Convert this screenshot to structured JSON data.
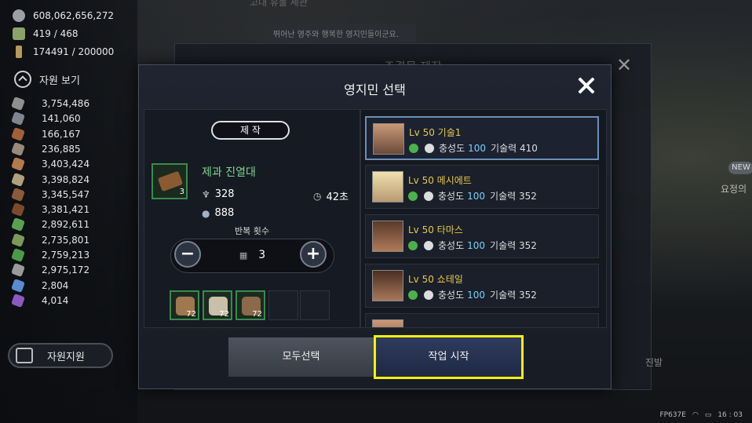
{
  "background": {
    "top_text": "고대 유물 세관",
    "top_box_text": "뛰어난 영주와 행복한 영지민들이군요.",
    "window_title": "주결물 제작",
    "side_badge": "NEW",
    "side_text": "요정의",
    "side_text2": "진발"
  },
  "top_stats": [
    {
      "icon": "silver-coin-icon",
      "color": "#9aa0a6",
      "value": "608,062,656,272"
    },
    {
      "icon": "lordship-icon",
      "color": "#8aa36a",
      "value": "419 / 468"
    },
    {
      "icon": "wheat-icon",
      "color": "#b59a5a",
      "value": "174491 / 200000"
    }
  ],
  "resource_toggle": "자원 보기",
  "resources": [
    {
      "icon": "ore-icon",
      "color": "#8f8f8f",
      "value": "3,754,486"
    },
    {
      "icon": "stone-icon",
      "color": "#7f8590",
      "value": "141,060"
    },
    {
      "icon": "wood-log-icon",
      "color": "#a0603a",
      "value": "166,167"
    },
    {
      "icon": "feather-icon",
      "color": "#9a8a7a",
      "value": "236,885"
    },
    {
      "icon": "hide-icon",
      "color": "#b37a50",
      "value": "3,403,424"
    },
    {
      "icon": "plank-icon",
      "color": "#b0a080",
      "value": "3,398,824"
    },
    {
      "icon": "timber-icon",
      "color": "#8a5a3a",
      "value": "3,345,547"
    },
    {
      "icon": "branch-icon",
      "color": "#7a4a2a",
      "value": "3,381,421"
    },
    {
      "icon": "leaf-icon",
      "color": "#5aa050",
      "value": "2,892,611"
    },
    {
      "icon": "herb-icon",
      "color": "#7a9a5a",
      "value": "2,735,801"
    },
    {
      "icon": "plant-icon",
      "color": "#4a9a4a",
      "value": "2,759,213"
    },
    {
      "icon": "rock-icon",
      "color": "#9a9a9a",
      "value": "2,975,172"
    },
    {
      "icon": "crystal-icon",
      "color": "#5a8ad0",
      "value": "2,804"
    },
    {
      "icon": "gem-icon",
      "color": "#8a5ac0",
      "value": "4,014"
    }
  ],
  "support_button": "자원지원",
  "modal": {
    "title": "영지민 선택",
    "craft_tag": "제 작",
    "item": {
      "name": "제과 진열대",
      "count": "3",
      "wheat": "328",
      "time": "42초",
      "silver": "888"
    },
    "repeat_label": "반복 횟수",
    "repeat_value": "3",
    "materials": [
      {
        "count": "72"
      },
      {
        "count": "72"
      },
      {
        "count": "72"
      }
    ],
    "workers": [
      {
        "name": "Lv 50 기술1",
        "loyalty_label": "충성도",
        "loyalty": "100",
        "skill_label": "기술력",
        "skill": "410"
      },
      {
        "name": "Lv 50 메시에트",
        "loyalty_label": "충성도",
        "loyalty": "100",
        "skill_label": "기술력",
        "skill": "352"
      },
      {
        "name": "Lv 50 타마스",
        "loyalty_label": "충성도",
        "loyalty": "100",
        "skill_label": "기술력",
        "skill": "352"
      },
      {
        "name": "Lv 50 쇼테일",
        "loyalty_label": "충성도",
        "loyalty": "100",
        "skill_label": "기술력",
        "skill": "352"
      }
    ],
    "select_all": "모두선택",
    "start_work": "작업 시작"
  },
  "status_bar": {
    "device": "FP637E",
    "time": "16 : 03"
  }
}
